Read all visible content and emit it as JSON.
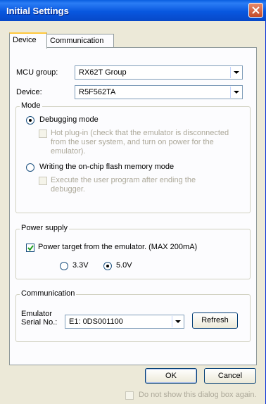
{
  "window": {
    "title": "Initial Settings"
  },
  "tabs": [
    {
      "label": "Device"
    },
    {
      "label": "Communication"
    }
  ],
  "device": {
    "mcu_group_label": "MCU group:",
    "mcu_group_value": "RX62T Group",
    "device_label": "Device:",
    "device_value": "R5F562TA"
  },
  "mode": {
    "title": "Mode",
    "debugging_label": "Debugging mode",
    "hot_plugin_label": "Hot plug-in (check that the emulator is disconnected from the user system, and turn on power for the emulator).",
    "writing_label": "Writing the on-chip flash memory mode",
    "execute_label": "Execute the user program after ending the debugger."
  },
  "power": {
    "title": "Power supply",
    "power_target_label": "Power target from the emulator. (MAX 200mA)",
    "v33_label": "3.3V",
    "v50_label": "5.0V"
  },
  "communication": {
    "title": "Communication",
    "serial_label_1": "Emulator",
    "serial_label_2": "Serial No.:",
    "serial_value": "E1: 0DS001100",
    "refresh_label": "Refresh"
  },
  "footer": {
    "ok_label": "OK",
    "cancel_label": "Cancel",
    "do_not_show_label": "Do not show this dialog box again."
  }
}
